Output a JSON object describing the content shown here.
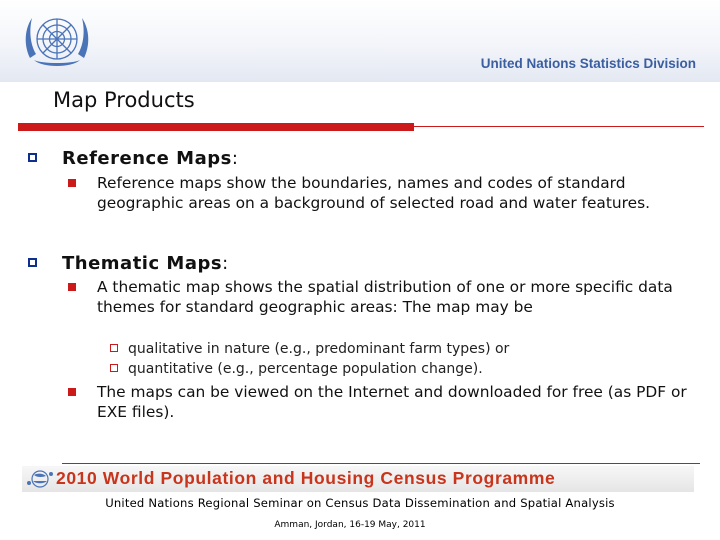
{
  "header": {
    "division": "United Nations Statistics Division",
    "logo_icon": "un-emblem-icon"
  },
  "slide": {
    "title": "Map Products",
    "sections": [
      {
        "heading": "Reference Maps",
        "colon": ":",
        "bullets": [
          "Reference maps show the boundaries, names and codes of standard geographic areas on a background of selected road and water features."
        ]
      },
      {
        "heading": "Thematic Maps",
        "colon": ":",
        "bullets": [
          "A thematic map shows the spatial distribution of one or more specific data themes for standard geographic areas: The map may be",
          "The maps can be viewed on the Internet and downloaded for free (as PDF or EXE files)."
        ],
        "subbullets": [
          "qualitative in nature (e.g., predominant farm types) or",
          "quantitative (e.g., percentage population change)."
        ]
      }
    ]
  },
  "footer": {
    "banner": "2010 World Population and Housing Census Programme",
    "banner_icon": "census-globe-icon",
    "seminar": "United Nations Regional Seminar on Census Data Dissemination and Spatial Analysis",
    "location": "Amman, Jordan, 16-19 May, 2011"
  },
  "colors": {
    "accent_red": "#cc1a1a",
    "bullet_blue": "#0f2f8f",
    "un_blue": "#3a5ea0",
    "banner_red": "#c8351c"
  }
}
